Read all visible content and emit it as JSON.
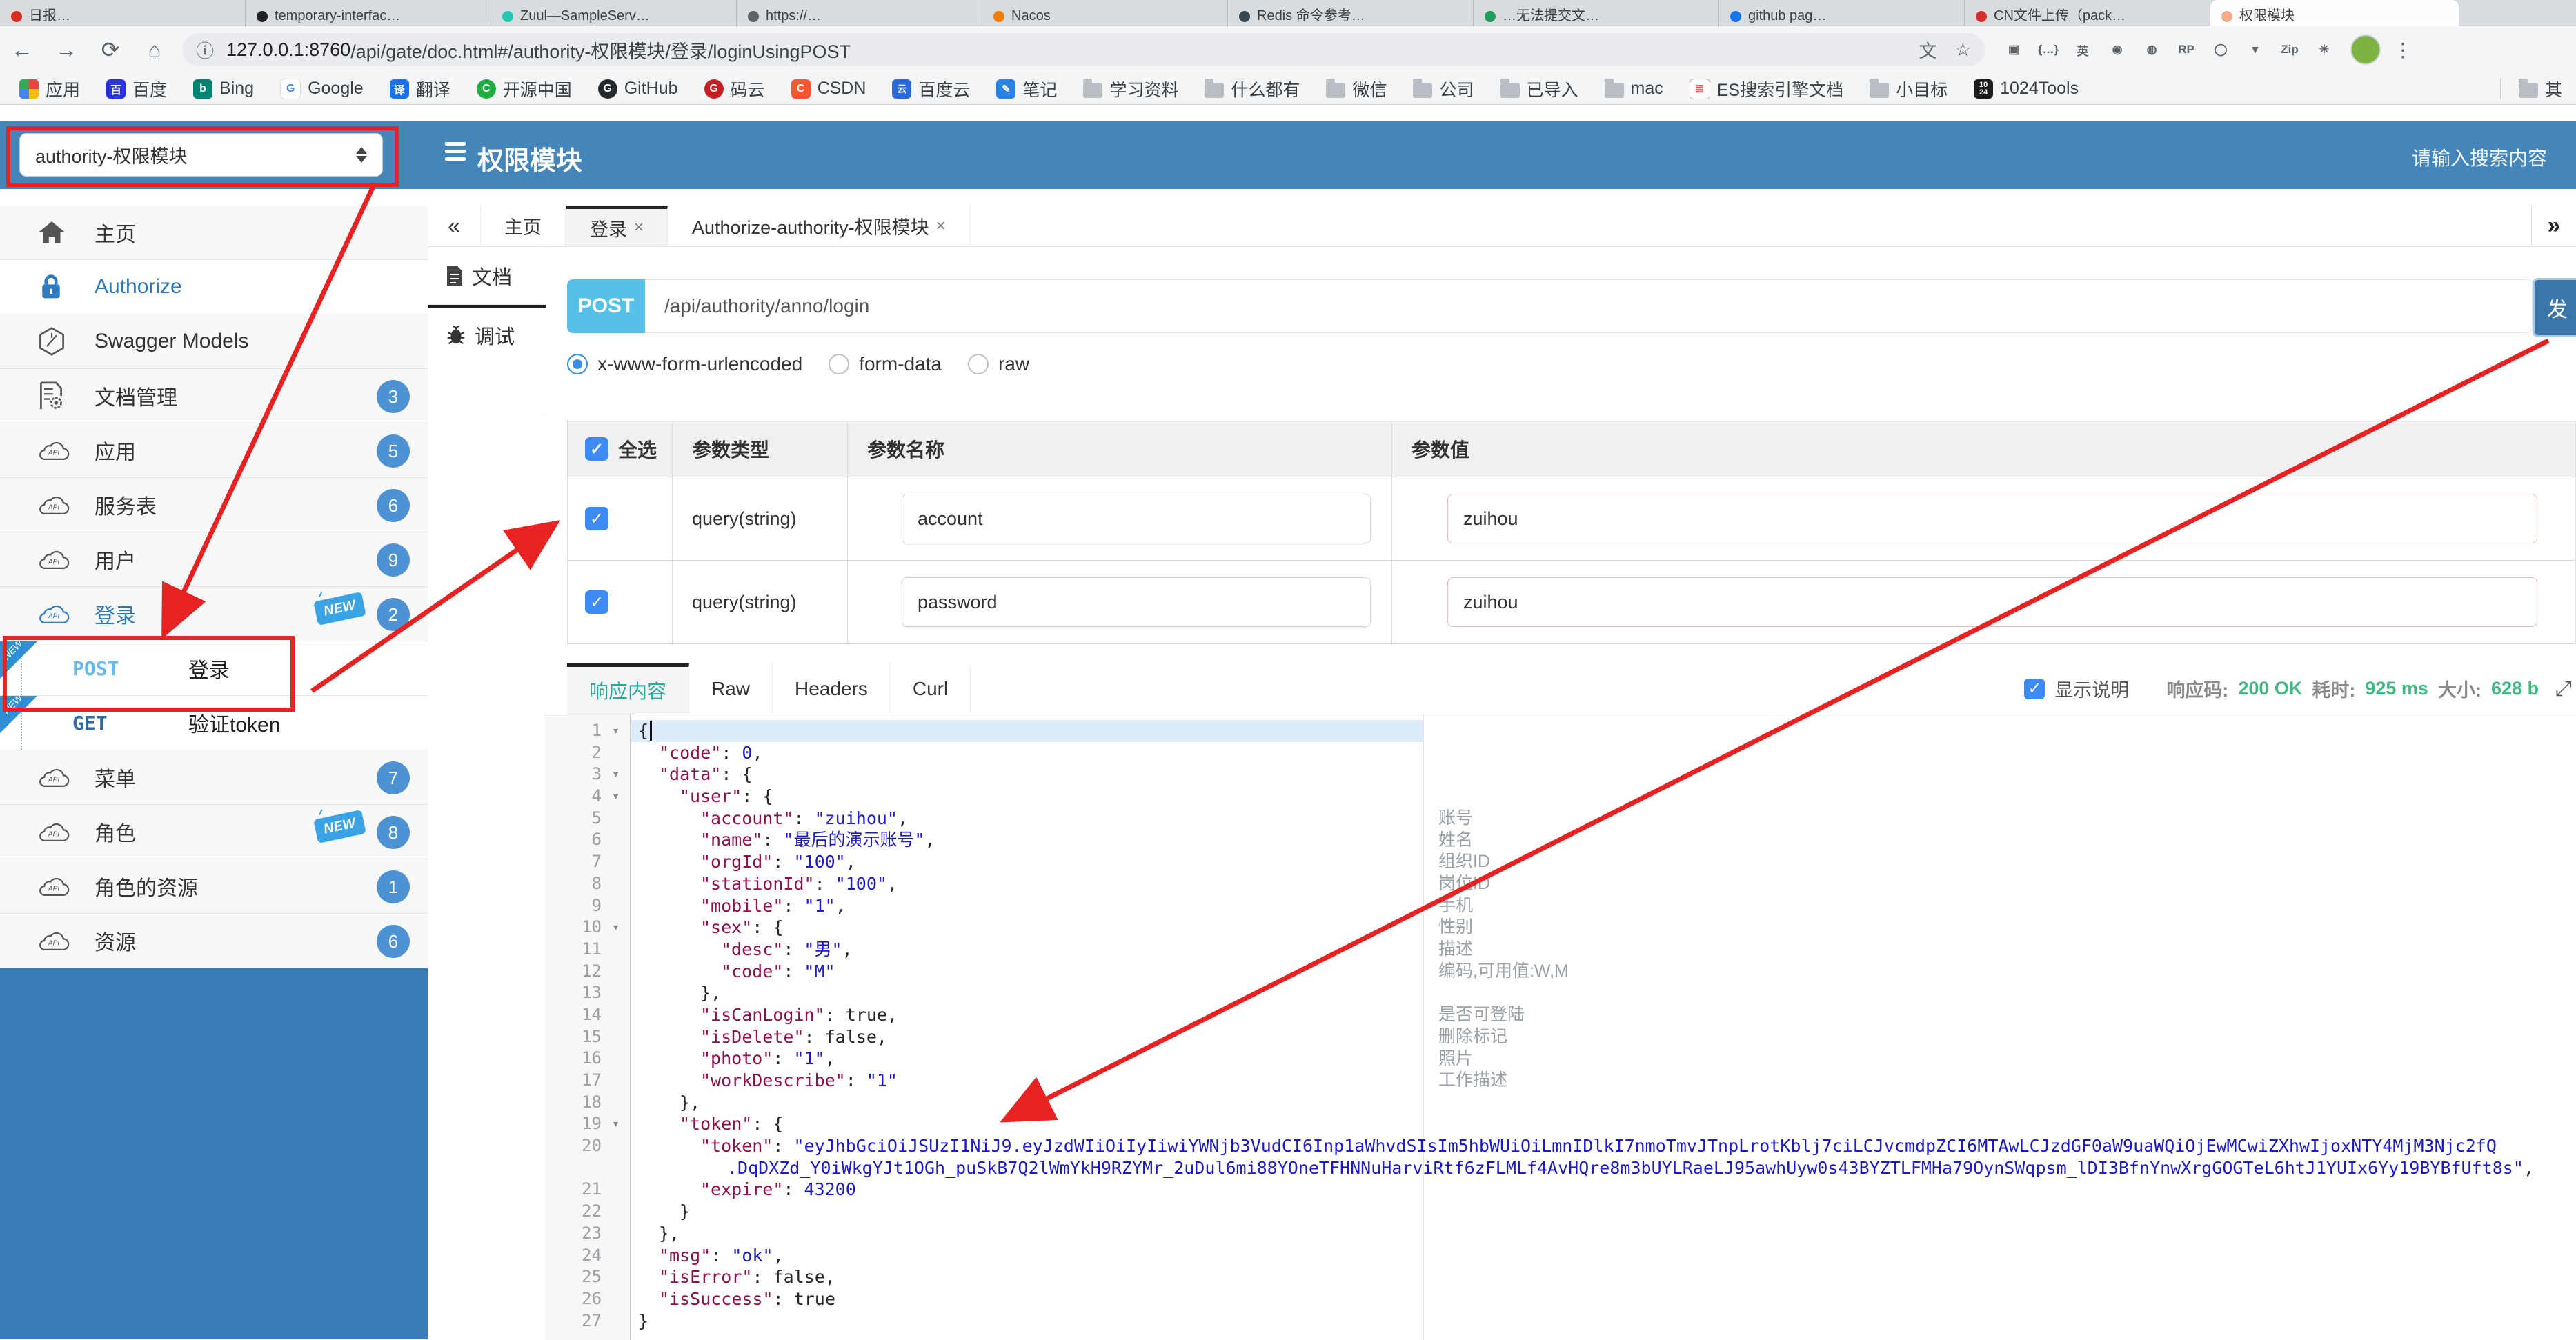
{
  "browser": {
    "tabs": [
      {
        "t": "日报…",
        "dot": "#d93025"
      },
      {
        "t": "temporary-interfac…",
        "dot": "#202124"
      },
      {
        "t": "Zuul—SampleServ…",
        "dot": "#26c6b0"
      },
      {
        "t": "https://…",
        "dot": "#5f6368"
      },
      {
        "t": "Nacos",
        "dot": "#f57c00"
      },
      {
        "t": "Redis 命令参考…",
        "dot": "#37474f"
      },
      {
        "t": "…无法提交文…",
        "dot": "#1e9e5a"
      },
      {
        "t": "github pag…",
        "dot": "#1a73e8"
      },
      {
        "t": "CN文件上传（pack…",
        "dot": "#d32f2f"
      },
      {
        "t": "权限模块",
        "dot": "#f4a988",
        "cls": "active"
      }
    ],
    "url_host": "127.0.0.1:8760",
    "url_path": "/api/gate/doc.html#/authority-权限模块/登录/loginUsingPOST",
    "bookmarks": [
      {
        "l": "应用",
        "ic": "grid"
      },
      {
        "l": "百度",
        "ic": "baidu"
      },
      {
        "l": "Bing",
        "ic": "bing"
      },
      {
        "l": "Google",
        "ic": "google"
      },
      {
        "l": "翻译",
        "ic": "trans"
      },
      {
        "l": "开源中国",
        "ic": "osc"
      },
      {
        "l": "GitHub",
        "ic": "gh"
      },
      {
        "l": "码云",
        "ic": "gitee"
      },
      {
        "l": "CSDN",
        "ic": "csdn"
      },
      {
        "l": "百度云",
        "ic": "byun"
      },
      {
        "l": "笔记",
        "ic": "note"
      },
      {
        "l": "学习资料",
        "ic": "folder"
      },
      {
        "l": "什么都有",
        "ic": "folder"
      },
      {
        "l": "微信",
        "ic": "folder"
      },
      {
        "l": "公司",
        "ic": "folder"
      },
      {
        "l": "已导入",
        "ic": "folder"
      },
      {
        "l": "mac",
        "ic": "folder"
      },
      {
        "l": "ES搜索引擎文档",
        "ic": "book"
      },
      {
        "l": "小目标",
        "ic": "folder"
      },
      {
        "l": "1024Tools",
        "ic": "t1024"
      }
    ],
    "bookmarks_other": "其",
    "extensions": [
      {
        "g": "▣"
      },
      {
        "g": "{…}"
      },
      {
        "g": "英"
      },
      {
        "g": "◉"
      },
      {
        "g": "◍"
      },
      {
        "g": "RP"
      },
      {
        "g": "◯"
      },
      {
        "g": "▾"
      },
      {
        "g": "Zip"
      },
      {
        "g": "✳"
      }
    ]
  },
  "header": {
    "module_select": "authority-权限模块",
    "title": "权限模块",
    "search_placeholder": "请输入搜索内容"
  },
  "sidebar": {
    "items": [
      {
        "api": 1,
        "icon": "home",
        "label": "主页"
      },
      {
        "api": 1,
        "icon": "lock",
        "label": "Authorize",
        "cls": "blue white"
      },
      {
        "api": 1,
        "icon": "hex",
        "label": "Swagger Models"
      },
      {
        "api": 1,
        "icon": "docgear",
        "label": "文档管理",
        "badge": "3"
      },
      {
        "api": 1,
        "icon": "cloud",
        "label": "应用",
        "badge": "5"
      },
      {
        "api": 1,
        "icon": "cloud",
        "label": "服务表",
        "badge": "6"
      },
      {
        "api": 1,
        "icon": "cloud",
        "label": "用户",
        "badge": "9"
      },
      {
        "api": 1,
        "icon": "cloud",
        "label": "登录",
        "badge": "2",
        "isNewTag": 1,
        "cls": "blue"
      },
      {
        "method": "POST",
        "label": "登录",
        "isRibbon": 1,
        "cls": "m post"
      },
      {
        "method": "GET",
        "label": "验证token",
        "isRibbon": 1,
        "cls": "m get"
      },
      {
        "api": 1,
        "icon": "cloud",
        "label": "菜单",
        "badge": "7"
      },
      {
        "api": 1,
        "icon": "cloud",
        "label": "角色",
        "badge": "8",
        "isNewTag": 1
      },
      {
        "api": 1,
        "icon": "cloud",
        "label": "角色的资源",
        "badge": "1"
      },
      {
        "api": 1,
        "icon": "cloud",
        "label": "资源",
        "badge": "6"
      }
    ]
  },
  "tabs": {
    "collapse": "«",
    "overflow": "»",
    "items": [
      {
        "label": "主页"
      },
      {
        "label": "登录",
        "close": "×",
        "cls": "active"
      },
      {
        "label": "Authorize-authority-权限模块",
        "close": "×"
      }
    ]
  },
  "doc_tabs": {
    "doc": "文档",
    "debug": "调试"
  },
  "request": {
    "method": "POST",
    "url": "/api/authority/anno/login",
    "send": "发",
    "body_types": [
      {
        "label": "x-www-form-urlencoded",
        "cls": "sel"
      },
      {
        "label": "form-data"
      },
      {
        "label": "raw"
      }
    ]
  },
  "params": {
    "headers": [
      "全选",
      "参数类型",
      "参数名称",
      "参数值"
    ],
    "rows": [
      {
        "type": "query(string)",
        "name": "account",
        "value": "zuihou"
      },
      {
        "type": "query(string)",
        "name": "password",
        "value": "zuihou"
      }
    ]
  },
  "response": {
    "tabs": [
      {
        "label": "响应内容",
        "cls": "active"
      },
      {
        "label": "Raw"
      },
      {
        "label": "Headers"
      },
      {
        "label": "Curl"
      }
    ],
    "show_desc": "显示说明",
    "code_label": "响应码:",
    "code_value": "200 OK",
    "time_label": "耗时:",
    "time_value": "925 ms",
    "size_label": "大小:",
    "size_value": "628 b"
  },
  "code": {
    "lines": [
      {
        "n": "1",
        "fold": 1,
        "sel": 1,
        "cursor": 1,
        "ind": 0,
        "t": [
          [
            "p",
            "{"
          ]
        ]
      },
      {
        "n": "2",
        "ind": 1,
        "t": [
          [
            "k",
            "\"code\""
          ],
          [
            "p",
            ": "
          ],
          [
            "n",
            "0"
          ],
          [
            "p",
            ","
          ]
        ]
      },
      {
        "n": "3",
        "fold": 1,
        "ind": 1,
        "t": [
          [
            "k",
            "\"data\""
          ],
          [
            "p",
            ": {"
          ]
        ]
      },
      {
        "n": "4",
        "fold": 1,
        "ind": 2,
        "t": [
          [
            "k",
            "\"user\""
          ],
          [
            "p",
            ": {"
          ]
        ]
      },
      {
        "n": "5",
        "ind": 3,
        "t": [
          [
            "k",
            "\"account\""
          ],
          [
            "p",
            ": "
          ],
          [
            "s",
            "\"zuihou\""
          ],
          [
            "p",
            ","
          ]
        ]
      },
      {
        "n": "6",
        "ind": 3,
        "t": [
          [
            "k",
            "\"name\""
          ],
          [
            "p",
            ": "
          ],
          [
            "s",
            "\"最后的演示账号\""
          ],
          [
            "p",
            ","
          ]
        ]
      },
      {
        "n": "7",
        "ind": 3,
        "t": [
          [
            "k",
            "\"orgId\""
          ],
          [
            "p",
            ": "
          ],
          [
            "s",
            "\"100\""
          ],
          [
            "p",
            ","
          ]
        ]
      },
      {
        "n": "8",
        "ind": 3,
        "t": [
          [
            "k",
            "\"stationId\""
          ],
          [
            "p",
            ": "
          ],
          [
            "s",
            "\"100\""
          ],
          [
            "p",
            ","
          ]
        ]
      },
      {
        "n": "9",
        "ind": 3,
        "t": [
          [
            "k",
            "\"mobile\""
          ],
          [
            "p",
            ": "
          ],
          [
            "s",
            "\"1\""
          ],
          [
            "p",
            ","
          ]
        ]
      },
      {
        "n": "10",
        "fold": 1,
        "ind": 3,
        "t": [
          [
            "k",
            "\"sex\""
          ],
          [
            "p",
            ": {"
          ]
        ]
      },
      {
        "n": "11",
        "ind": 4,
        "t": [
          [
            "k",
            "\"desc\""
          ],
          [
            "p",
            ": "
          ],
          [
            "s",
            "\"男\""
          ],
          [
            "p",
            ","
          ]
        ]
      },
      {
        "n": "12",
        "ind": 4,
        "t": [
          [
            "k",
            "\"code\""
          ],
          [
            "p",
            ": "
          ],
          [
            "s",
            "\"M\""
          ]
        ]
      },
      {
        "n": "13",
        "ind": 3,
        "t": [
          [
            "p",
            "},"
          ]
        ]
      },
      {
        "n": "14",
        "ind": 3,
        "t": [
          [
            "k",
            "\"isCanLogin\""
          ],
          [
            "p",
            ": "
          ],
          [
            "b",
            "true"
          ],
          [
            "p",
            ","
          ]
        ]
      },
      {
        "n": "15",
        "ind": 3,
        "t": [
          [
            "k",
            "\"isDelete\""
          ],
          [
            "p",
            ": "
          ],
          [
            "b",
            "false"
          ],
          [
            "p",
            ","
          ]
        ]
      },
      {
        "n": "16",
        "ind": 3,
        "t": [
          [
            "k",
            "\"photo\""
          ],
          [
            "p",
            ": "
          ],
          [
            "s",
            "\"1\""
          ],
          [
            "p",
            ","
          ]
        ]
      },
      {
        "n": "17",
        "ind": 3,
        "t": [
          [
            "k",
            "\"workDescribe\""
          ],
          [
            "p",
            ": "
          ],
          [
            "s",
            "\"1\""
          ]
        ]
      },
      {
        "n": "18",
        "ind": 2,
        "t": [
          [
            "p",
            "},"
          ]
        ]
      },
      {
        "n": "19",
        "fold": 1,
        "ind": 2,
        "t": [
          [
            "k",
            "\"token\""
          ],
          [
            "p",
            ": {"
          ]
        ]
      },
      {
        "n": "20",
        "ind": 3,
        "t": [
          [
            "k",
            "\"token\""
          ],
          [
            "p",
            ": "
          ],
          [
            "s",
            "\"eyJhbGciOiJSUzI1NiJ9.eyJzdWIiOiIyIiwiYWNjb3VudCI6Inp1aWhvdSIsIm5hbWUiOiLmnIDlkI7nmoTmvJTnpLrotKblj7ciLCJvcmdpZCI6MTAwLCJzdGF0aW9uaWQiOjEwMCwiZXhwIjoxNTY4MjM3Njc2fQ"
          ]
        ]
      },
      {
        "ind": 4.3,
        "t": [
          [
            "s",
            ".DqDXZd_Y0iWkgYJt1OGh_puSkB7Q2lWmYkH9RZYMr_2uDul6mi88YOneTFHNNuHarviRtf6zFLMLf4AvHQre8m3bUYLRaeLJ95awhUyw0s43BYZTLFMHa79OynSWqpsm_lDI3BfnYnwXrgGOGTeL6htJ1YUIx6Yy19BYBfUft8s\""
          ],
          [
            "p",
            ","
          ]
        ]
      },
      {
        "n": "21",
        "ind": 3,
        "t": [
          [
            "k",
            "\"expire\""
          ],
          [
            "p",
            ": "
          ],
          [
            "n",
            "43200"
          ]
        ]
      },
      {
        "n": "22",
        "ind": 2,
        "t": [
          [
            "p",
            "}"
          ]
        ]
      },
      {
        "n": "23",
        "ind": 1,
        "t": [
          [
            "p",
            "},"
          ]
        ]
      },
      {
        "n": "24",
        "ind": 1,
        "t": [
          [
            "k",
            "\"msg\""
          ],
          [
            "p",
            ": "
          ],
          [
            "s",
            "\"ok\""
          ],
          [
            "p",
            ","
          ]
        ]
      },
      {
        "n": "25",
        "ind": 1,
        "t": [
          [
            "k",
            "\"isError\""
          ],
          [
            "p",
            ": "
          ],
          [
            "b",
            "false"
          ],
          [
            "p",
            ","
          ]
        ]
      },
      {
        "n": "26",
        "ind": 1,
        "t": [
          [
            "k",
            "\"isSuccess\""
          ],
          [
            "p",
            ": "
          ],
          [
            "b",
            "true"
          ]
        ]
      },
      {
        "n": "27",
        "ind": 0,
        "t": [
          [
            "p",
            "}"
          ]
        ]
      }
    ],
    "annotations": [
      "账号",
      "姓名",
      "组织ID",
      "岗位ID",
      "手机",
      "性别",
      "描述",
      "编码,可用值:W,M",
      "",
      "是否可登陆",
      "删除标记",
      "照片",
      "工作描述"
    ]
  },
  "colors": {
    "header_blue": "#4486ba",
    "sidebar_blue": "#3a7cb8",
    "post_badge": "#55c0e8",
    "badge_blue": "#4d92d3",
    "status_green": "#42b983",
    "annotation_red": "#e62222"
  }
}
